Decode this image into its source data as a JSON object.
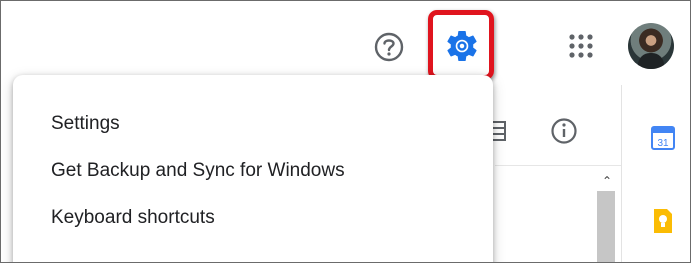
{
  "header": {
    "icons": {
      "help": "help-circle-icon",
      "settings": "gear-icon",
      "apps": "apps-grid-icon",
      "account": "avatar"
    },
    "highlight_color": "#e0141e",
    "accent_color": "#1a73e8"
  },
  "settings_menu": {
    "items": [
      {
        "label": "Settings"
      },
      {
        "label": "Get Backup and Sync for Windows"
      },
      {
        "label": "Keyboard shortcuts"
      }
    ]
  },
  "side_panel": {
    "icons": [
      "calendar-icon",
      "keep-icon"
    ],
    "calendar_day": "31"
  }
}
